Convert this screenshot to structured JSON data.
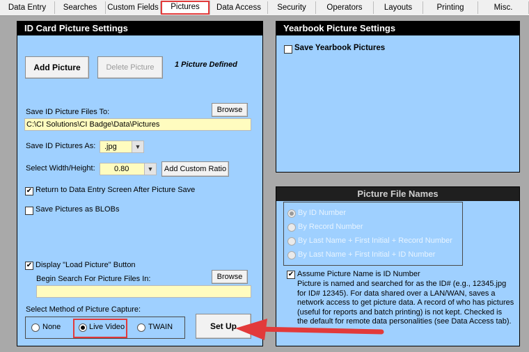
{
  "tabs": [
    "Data Entry",
    "Searches",
    "Custom Fields",
    "Pictures",
    "Data Access",
    "Security",
    "Operators",
    "Layouts",
    "Printing",
    "Misc."
  ],
  "active_tab": "Pictures",
  "id_card": {
    "title": "ID Card Picture Settings",
    "add_picture": "Add Picture",
    "delete_picture": "Delete Picture",
    "picture_count": "1 Picture Defined",
    "save_to_label": "Save ID Picture Files To:",
    "browse": "Browse",
    "save_path": "C:\\CI Solutions\\CI Badge\\Data\\Pictures",
    "save_as_label": "Save ID Pictures As:",
    "save_as_value": ".jpg",
    "width_height_label": "Select Width/Height:",
    "width_height_value": "0.80",
    "add_custom_ratio": "Add Custom Ratio",
    "return_to_entry": "Return to Data Entry Screen After Picture Save",
    "return_to_entry_checked": true,
    "save_blobs": "Save Pictures as BLOBs",
    "save_blobs_checked": false,
    "display_load": "Display \"Load Picture\" Button",
    "display_load_checked": true,
    "begin_search_label": "Begin Search For Picture Files In:",
    "begin_search_value": "",
    "capture_label": "Select Method of Picture Capture:",
    "capture_options": [
      "None",
      "Live Video",
      "TWAIN"
    ],
    "capture_selected": "Live Video",
    "setup": "Set Up"
  },
  "yearbook": {
    "title": "Yearbook Picture Settings",
    "save_yearbook": "Save Yearbook Pictures",
    "save_yearbook_checked": false
  },
  "file_names": {
    "title": "Picture File Names",
    "options": [
      "By ID Number",
      "By Record Number",
      "By Last Name + First Initial + Record Number",
      "By Last Name + First Initial + ID Number"
    ],
    "selected": "By ID Number",
    "assume_label": "Assume Picture Name is ID Number",
    "assume_checked": true,
    "description": "Picture is named and searched for as the ID# (e.g., 12345.jpg for ID# 12345).  For data shared over a LAN/WAN, saves a network access to get picture data. A record of who has pictures (useful for reports and batch printing) is not kept. Checked is the default for remote data personalities (see Data Access tab)."
  },
  "colors": {
    "panel": "#9fd0ff",
    "highlight": "#e23a3a",
    "field": "#fffcbf"
  }
}
